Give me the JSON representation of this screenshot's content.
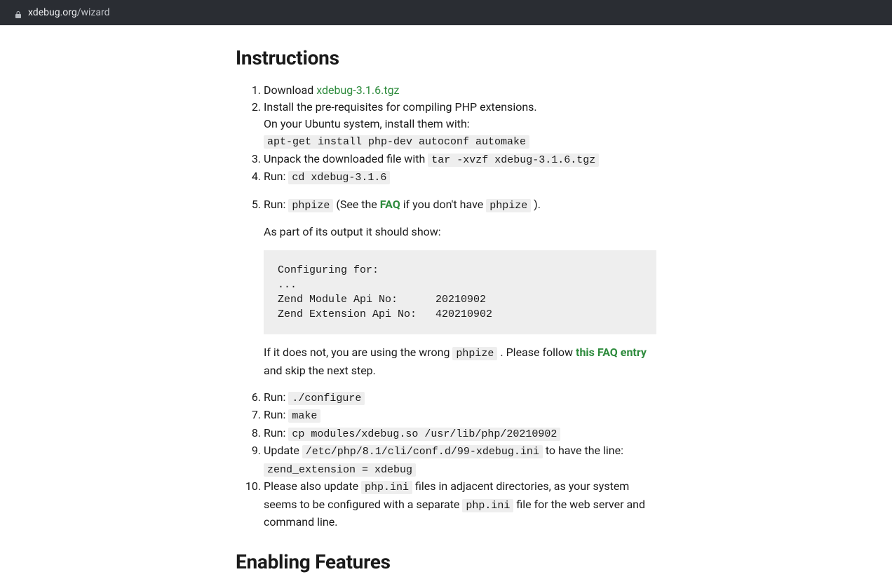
{
  "url": {
    "domain": "xdebug.org",
    "path": "/wizard"
  },
  "heading": "Instructions",
  "steps": {
    "s1": {
      "prefix": "Download ",
      "link": "xdebug-3.1.6.tgz"
    },
    "s2": {
      "line1": "Install the pre-requisites for compiling PHP extensions.",
      "line2": "On your Ubuntu system, install them with:",
      "cmd": "apt-get install php-dev autoconf automake"
    },
    "s3": {
      "text": "Unpack the downloaded file with ",
      "cmd": "tar -xvzf xdebug-3.1.6.tgz"
    },
    "s4": {
      "run": "Run: ",
      "cmd": "cd xdebug-3.1.6"
    },
    "s5": {
      "run": "Run: ",
      "cmd": "phpize",
      "mid1": " (See the ",
      "faq": "FAQ",
      "mid2": " if you don't have ",
      "cmd2": "phpize",
      "tail": " ).",
      "outputIntro": "As part of its output it should show:",
      "block": "Configuring for:\n...\nZend Module Api No:      20210902\nZend Extension Api No:   420210902",
      "after1": "If it does not, you are using the wrong ",
      "afterCmd": "phpize",
      "after2": " . Please follow ",
      "faqLink": "this FAQ entry",
      "after3": " and skip the next step."
    },
    "s6": {
      "run": "Run: ",
      "cmd": "./configure"
    },
    "s7": {
      "run": "Run: ",
      "cmd": "make"
    },
    "s8": {
      "run": "Run: ",
      "cmd": "cp modules/xdebug.so /usr/lib/php/20210902"
    },
    "s9": {
      "text1": "Update ",
      "cmd1": "/etc/php/8.1/cli/conf.d/99-xdebug.ini",
      "text2": " to have the line:",
      "cmd2": "zend_extension = xdebug"
    },
    "s10": {
      "text1": "Please also update ",
      "cmd1": "php.ini",
      "text2": " files in adjacent directories, as your system seems to be configured with a separate ",
      "cmd2": "php.ini",
      "text3": " file for the web server and command line."
    }
  },
  "heading2": "Enabling Features"
}
